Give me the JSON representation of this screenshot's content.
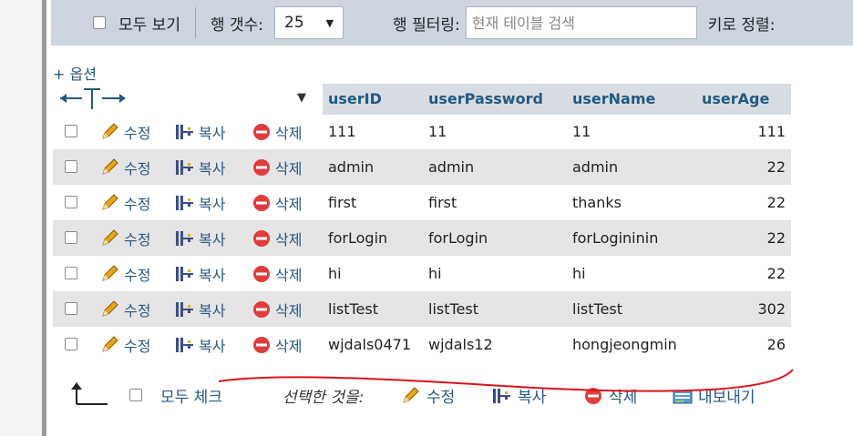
{
  "toolbar": {
    "show_all_label": "모두 보기",
    "rows_label": "행 갯수:",
    "rows_value": "25",
    "filter_label": "행 필터링:",
    "filter_placeholder": "현재 테이블 검색",
    "sort_label": "키로 정렬:"
  },
  "options_link": "+ 옵션",
  "columns": [
    "userID",
    "userPassword",
    "userName",
    "userAge"
  ],
  "actions": {
    "edit": "수정",
    "copy": "복사",
    "delete": "삭제"
  },
  "rows": [
    {
      "userID": "111",
      "userPassword": "11",
      "userName": "11",
      "userAge": "111"
    },
    {
      "userID": "admin",
      "userPassword": "admin",
      "userName": "admin",
      "userAge": "22"
    },
    {
      "userID": "first",
      "userPassword": "first",
      "userName": "thanks",
      "userAge": "22"
    },
    {
      "userID": "forLogin",
      "userPassword": "forLogin",
      "userName": "forLogininin",
      "userAge": "22"
    },
    {
      "userID": "hi",
      "userPassword": "hi",
      "userName": "hi",
      "userAge": "22"
    },
    {
      "userID": "listTest",
      "userPassword": "listTest",
      "userName": "listTest",
      "userAge": "302"
    },
    {
      "userID": "wjdals0471",
      "userPassword": "wjdals12",
      "userName": "hongjeongmin",
      "userAge": "26"
    }
  ],
  "footer": {
    "check_all": "모두 체크",
    "with_selected": "선택한 것을:",
    "edit": "수정",
    "copy": "복사",
    "delete": "삭제",
    "export": "내보내기"
  },
  "colors": {
    "link": "#235a81",
    "toolbar_bg": "#cbd4df",
    "header_bg": "#d8dde4",
    "stripe_bg": "#e5e5e5",
    "annotation": "#d9151b"
  },
  "icons": {
    "edit": "pencil-icon",
    "copy": "copy-icon",
    "delete": "delete-icon",
    "export": "export-icon"
  }
}
